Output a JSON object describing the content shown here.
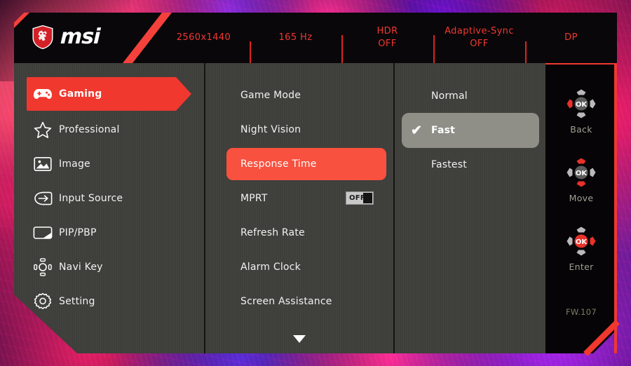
{
  "header": {
    "logo_icon": "msi-dragon-shield-icon",
    "brand": "msi",
    "items": [
      {
        "name": "resolution",
        "line1": "2560x1440",
        "line2": ""
      },
      {
        "name": "refresh-rate",
        "line1": "165 Hz",
        "line2": ""
      },
      {
        "name": "hdr",
        "line1": "HDR",
        "line2": "OFF"
      },
      {
        "name": "adaptive-sync",
        "line1": "Adaptive-Sync",
        "line2": "OFF"
      },
      {
        "name": "input-port",
        "line1": "DP",
        "line2": ""
      }
    ]
  },
  "sidebar": {
    "items": [
      {
        "label": "Gaming",
        "icon": "gamepad-icon",
        "active": true
      },
      {
        "label": "Professional",
        "icon": "star-icon",
        "active": false
      },
      {
        "label": "Image",
        "icon": "picture-icon",
        "active": false
      },
      {
        "label": "Input Source",
        "icon": "arrow-in-box-icon",
        "active": false
      },
      {
        "label": "PIP/PBP",
        "icon": "pip-pbp-icon",
        "active": false
      },
      {
        "label": "Navi Key",
        "icon": "navi-key-icon",
        "active": false
      },
      {
        "label": "Setting",
        "icon": "gear-icon",
        "active": false
      }
    ]
  },
  "submenu": {
    "items": [
      {
        "label": "Game Mode",
        "active": false,
        "toggle": null
      },
      {
        "label": "Night Vision",
        "active": false,
        "toggle": null
      },
      {
        "label": "Response Time",
        "active": true,
        "toggle": null
      },
      {
        "label": "MPRT",
        "active": false,
        "toggle": "OFF"
      },
      {
        "label": "Refresh Rate",
        "active": false,
        "toggle": null
      },
      {
        "label": "Alarm Clock",
        "active": false,
        "toggle": null
      },
      {
        "label": "Screen Assistance",
        "active": false,
        "toggle": null
      }
    ],
    "scroll_more_icon": "chevron-down-icon"
  },
  "options": {
    "title_context": "Response Time",
    "items": [
      {
        "label": "Normal",
        "selected": false
      },
      {
        "label": "Fast",
        "selected": true
      },
      {
        "label": "Fastest",
        "selected": false
      }
    ],
    "check_glyph": "✔"
  },
  "navigation": {
    "hints": [
      {
        "label": "Back",
        "icon": "navi-left-icon",
        "ok_active": false,
        "dirs": "left"
      },
      {
        "label": "Move",
        "icon": "navi-updown-icon",
        "ok_active": false,
        "dirs": "updown"
      },
      {
        "label": "Enter",
        "icon": "navi-enter-icon",
        "ok_active": true,
        "dirs": "right"
      }
    ],
    "firmware": "FW.107"
  },
  "colors": {
    "accent_red": "#f0382f",
    "highlight_orange": "#f9513f",
    "panel_grey": "#3f3f3b",
    "panel_black": "#060406",
    "selected_grey": "#8f8f88",
    "text_white": "#f2f2f2",
    "hint_grey": "#9f9f93",
    "firmware_grey": "#7d7d63"
  }
}
